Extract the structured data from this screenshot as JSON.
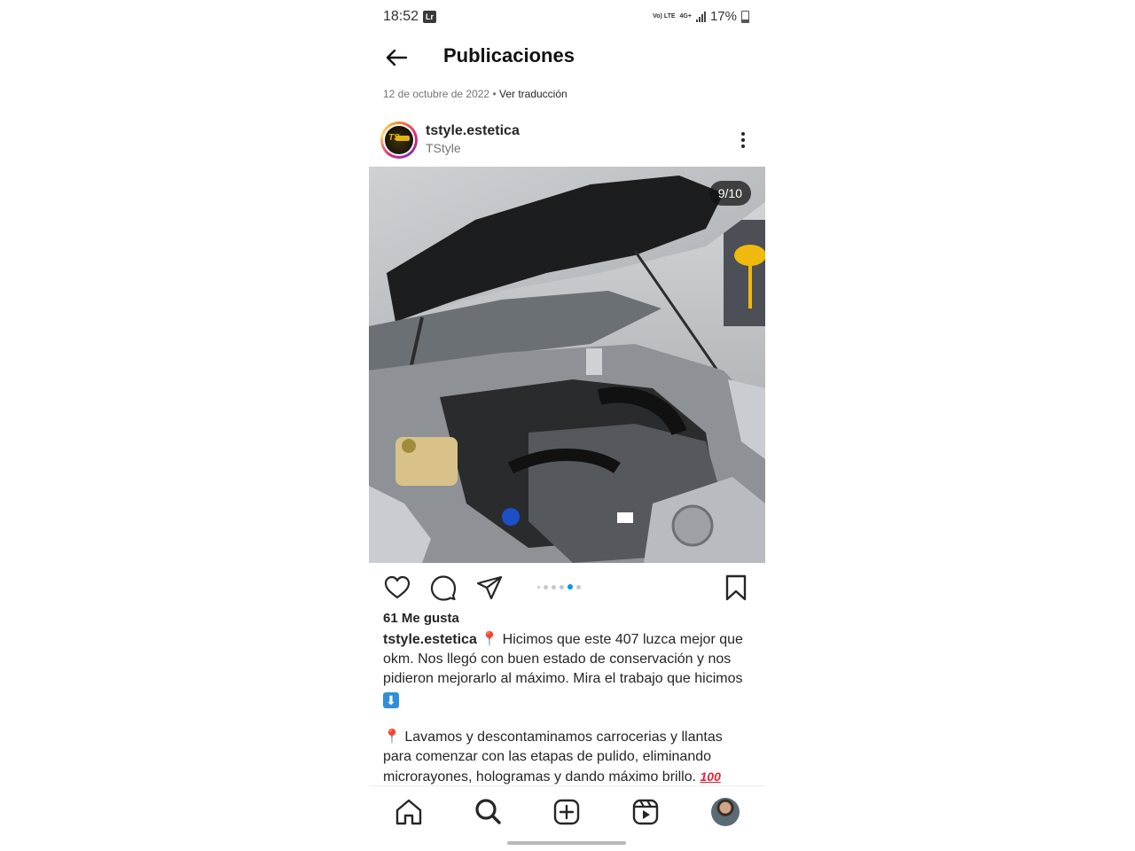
{
  "status_bar": {
    "time": "18:52",
    "app_badge": "Lr",
    "volte": "Vo) LTE",
    "network": "4G+",
    "battery": "17%"
  },
  "header": {
    "title": "Publicaciones"
  },
  "post": {
    "date": "12 de octubre de 2022",
    "separator": " • ",
    "translate_label": "Ver traducción",
    "username": "tstyle.estetica",
    "subtitle": "TStyle",
    "avatar_text": "TS",
    "counter": "9/10",
    "carousel": {
      "total_dots": 6,
      "active_index": 4
    },
    "likes": "61 Me gusta",
    "caption_user": "tstyle.estetica",
    "caption_line1": " Hicimos que este 407 luzca mejor que okm. Nos llegó con buen estado de conservación y nos pidieron mejorarlo al máximo. Mira el trabajo que hicimos",
    "caption_line2": " Lavamos y descontaminamos carrocerias y llantas para comenzar con las etapas de pulido, eliminando microrayones, hologramas y dando máximo brillo.",
    "emoji_pin": "📍",
    "emoji_arrow": "⬇",
    "emoji_hundred": "100"
  },
  "colors": {
    "accent": "#0095f6",
    "text": "#262626",
    "muted": "#737373"
  },
  "icons": {
    "back": "arrow-left",
    "more": "vertical-dots",
    "like": "heart",
    "comment": "speech-bubble",
    "share": "paper-plane",
    "save": "bookmark",
    "nav": [
      "home",
      "search",
      "add",
      "reels",
      "profile"
    ]
  }
}
